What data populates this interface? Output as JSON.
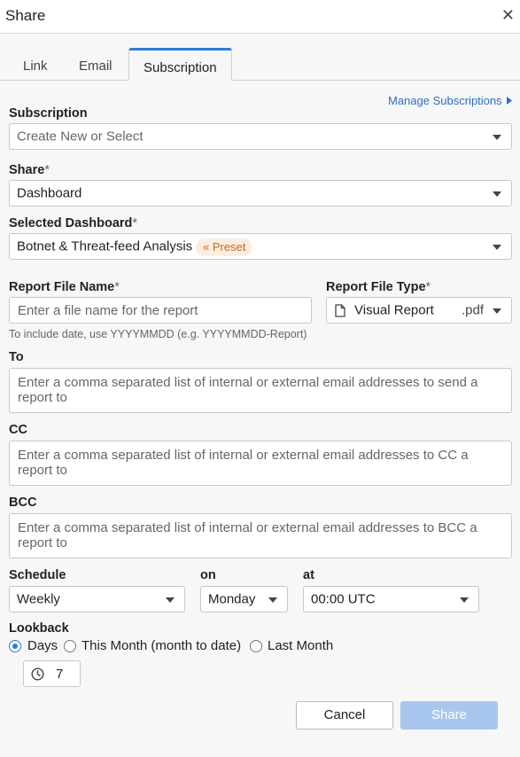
{
  "dialog": {
    "title": "Share"
  },
  "tabs": [
    {
      "label": "Link"
    },
    {
      "label": "Email"
    },
    {
      "label": "Subscription"
    }
  ],
  "manage_link": "Manage Subscriptions",
  "subscription": {
    "label": "Subscription",
    "value": "Create New or Select"
  },
  "share": {
    "label": "Share",
    "required": "*",
    "value": "Dashboard"
  },
  "dashboard": {
    "label": "Selected Dashboard",
    "required": "*",
    "value": "Botnet & Threat-feed Analysis",
    "badge": "Preset"
  },
  "report_name": {
    "label": "Report File Name",
    "required": "*",
    "placeholder": "Enter a file name for the report",
    "hint": "To include date, use YYYYMMDD (e.g. YYYYMMDD-Report)"
  },
  "report_type": {
    "label": "Report File Type",
    "required": "*",
    "value": "Visual Report",
    "ext": ".pdf"
  },
  "to": {
    "label": "To",
    "placeholder": "Enter a comma separated list of internal or external email addresses to send a report to"
  },
  "cc": {
    "label": "CC",
    "placeholder": "Enter a comma separated list of internal or external email addresses to CC a report to"
  },
  "bcc": {
    "label": "BCC",
    "placeholder": "Enter a comma separated list of internal or external email addresses to BCC a report to"
  },
  "schedule": {
    "label": "Schedule",
    "value": "Weekly",
    "on_label": "on",
    "on_value": "Monday",
    "at_label": "at",
    "at_value": "00:00 UTC"
  },
  "lookback": {
    "label": "Lookback",
    "options": [
      {
        "label": "Days",
        "selected": true
      },
      {
        "label": "This Month (month to date)",
        "selected": false
      },
      {
        "label": "Last Month",
        "selected": false
      }
    ],
    "days_value": "7"
  },
  "buttons": {
    "cancel": "Cancel",
    "share": "Share"
  },
  "colors": {
    "accent": "#2d7bd6",
    "link": "#2d6fc3",
    "preset_bg": "#fbeee0",
    "preset_fg": "#c46a1f",
    "share_disabled": "#a9c7ee"
  },
  "icons": {
    "close": "close-icon",
    "caret": "caret-right-icon",
    "file": "file-icon",
    "clock": "clock-icon",
    "preset": "chevrons-left-icon"
  }
}
